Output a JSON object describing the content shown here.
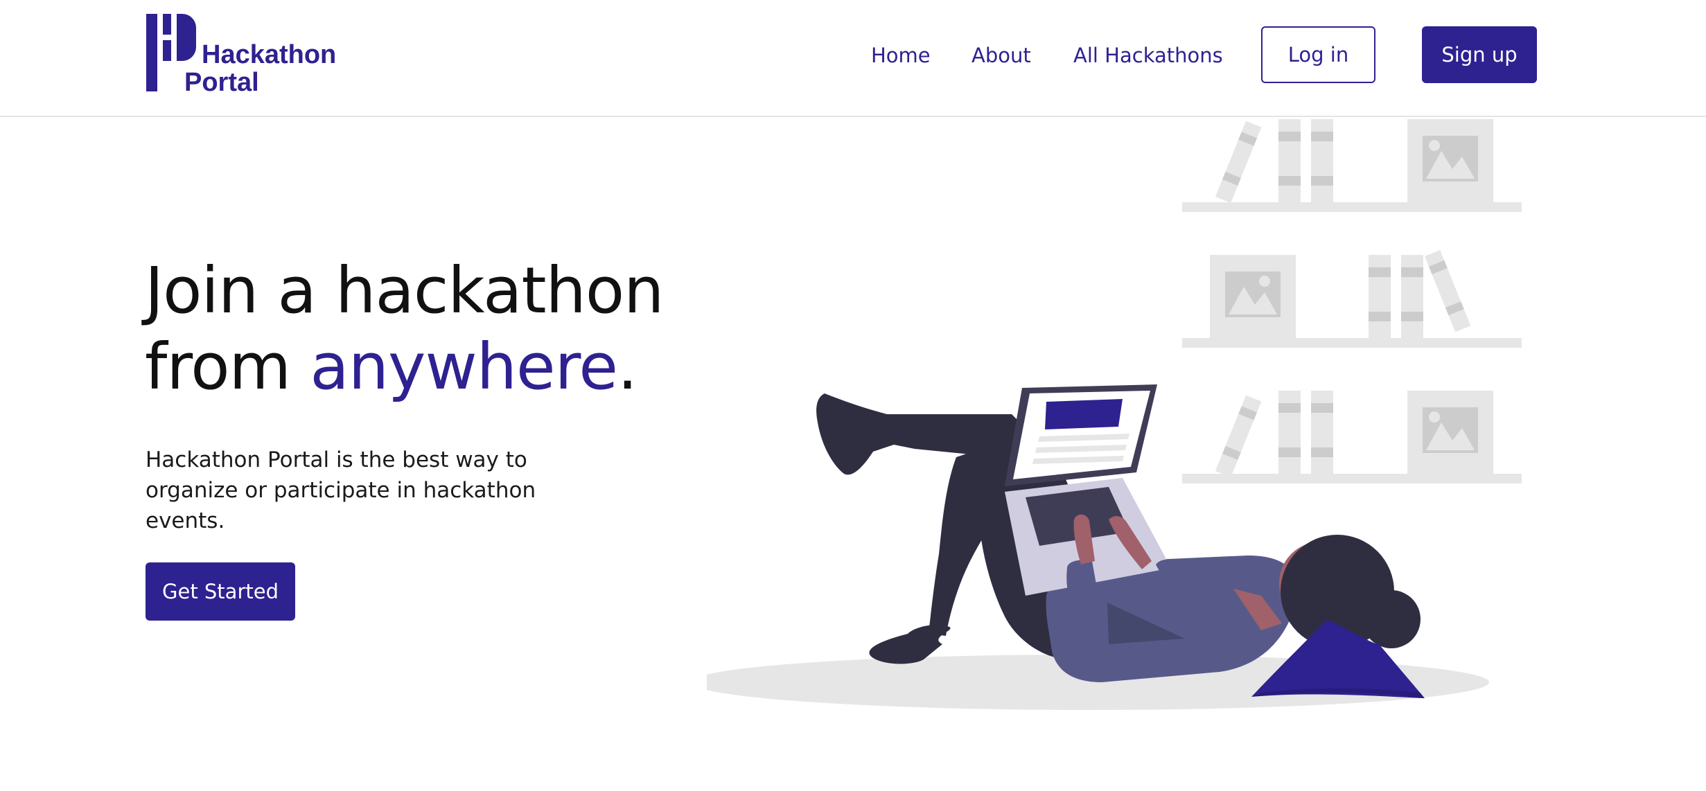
{
  "header": {
    "logo": {
      "line1": "Hackathon",
      "line2": "Portal"
    },
    "nav": {
      "home": "Home",
      "about": "About",
      "all_hackathons": "All Hackathons"
    },
    "login_label": "Log in",
    "signup_label": "Sign up"
  },
  "hero": {
    "title_part1": "Join a hackathon",
    "title_part2": "from ",
    "title_accent": "anywhere",
    "title_end": ".",
    "description": "Hackathon Portal is the best way to organize or participate in hackathon events.",
    "cta_label": "Get Started"
  },
  "colors": {
    "brand": "#2e2190",
    "text": "#111111",
    "shelf_gray": "#e6e6e6",
    "figure_dark": "#2f2e41",
    "sweater": "#575a89",
    "skin": "#a0616a"
  }
}
